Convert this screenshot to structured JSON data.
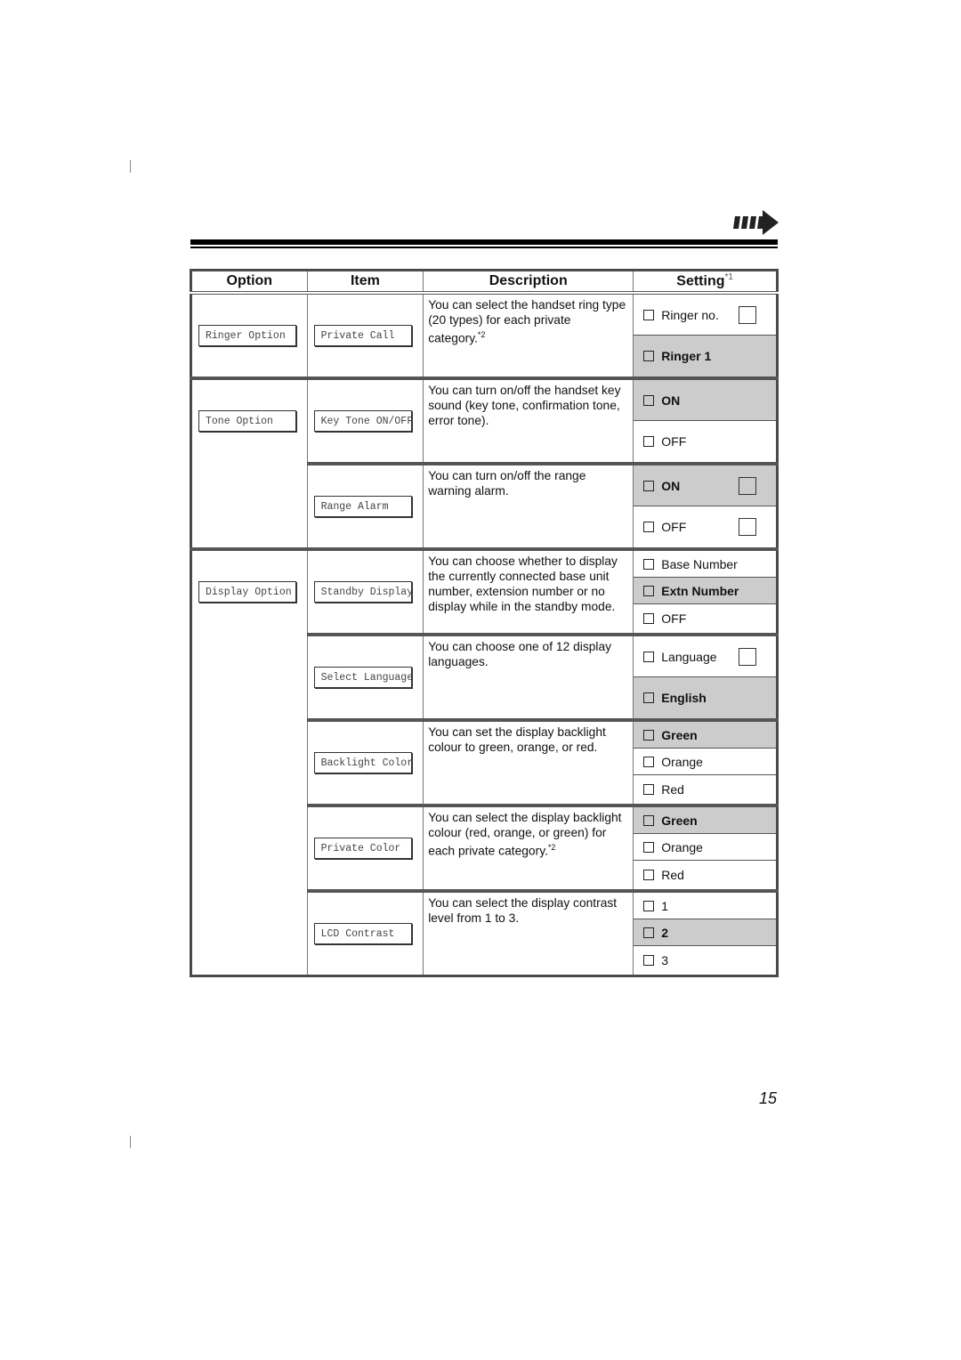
{
  "page": {
    "number": "15"
  },
  "header": {
    "continue_icon": "continue-arrow-icon"
  },
  "table": {
    "columns": [
      "Option",
      "Item",
      "Description",
      "Setting"
    ],
    "setting_footnote": "*1",
    "groups": [
      {
        "option": "Ringer Option",
        "items": [
          {
            "item": "Private Call",
            "description": "You can select the handset ring type (20 types) for each private category.",
            "footnote": "*2",
            "settings": [
              {
                "label": "Ringer no.",
                "selected": false,
                "entry_box": true
              },
              {
                "label": "Ringer 1",
                "selected": true,
                "entry_box": false
              }
            ]
          }
        ]
      },
      {
        "option": "Tone Option",
        "items": [
          {
            "item": "Key Tone ON/OFF",
            "description": "You can turn on/off the handset key sound (key tone, confirmation tone, error tone).",
            "footnote": "",
            "settings": [
              {
                "label": "ON",
                "selected": true,
                "entry_box": false
              },
              {
                "label": "OFF",
                "selected": false,
                "entry_box": false
              }
            ]
          },
          {
            "item": "Range Alarm",
            "description": "You can turn on/off the range warning alarm.",
            "footnote": "",
            "settings": [
              {
                "label": "ON",
                "selected": true,
                "entry_box": true
              },
              {
                "label": "OFF",
                "selected": false,
                "entry_box": true
              }
            ]
          }
        ]
      },
      {
        "option": "Display Option",
        "items": [
          {
            "item": "Standby Display",
            "description": "You can choose whether to display the currently connected base unit number, extension number or no display while in the standby mode.",
            "footnote": "",
            "settings": [
              {
                "label": "Base Number",
                "selected": false,
                "entry_box": false
              },
              {
                "label": "Extn Number",
                "selected": true,
                "entry_box": false
              },
              {
                "label": "OFF",
                "selected": false,
                "entry_box": false
              }
            ]
          },
          {
            "item": "Select Language",
            "description": "You can choose one of 12 display languages.",
            "footnote": "",
            "settings": [
              {
                "label": "Language",
                "selected": false,
                "entry_box": true
              },
              {
                "label": "English",
                "selected": true,
                "entry_box": false
              }
            ]
          },
          {
            "item": "Backlight Color",
            "description": "You can set the display backlight colour to green, orange, or red.",
            "footnote": "",
            "settings": [
              {
                "label": "Green",
                "selected": true,
                "entry_box": false
              },
              {
                "label": "Orange",
                "selected": false,
                "entry_box": false
              },
              {
                "label": "Red",
                "selected": false,
                "entry_box": false
              }
            ]
          },
          {
            "item": "Private Color",
            "description": "You can select the display backlight colour (red, orange, or green) for each private category.",
            "footnote": "*2",
            "settings": [
              {
                "label": "Green",
                "selected": true,
                "entry_box": false
              },
              {
                "label": "Orange",
                "selected": false,
                "entry_box": false
              },
              {
                "label": "Red",
                "selected": false,
                "entry_box": false
              }
            ]
          },
          {
            "item": "LCD Contrast",
            "description": "You can select the display contrast level from 1 to 3.",
            "footnote": "",
            "settings": [
              {
                "label": "1",
                "selected": false,
                "entry_box": false
              },
              {
                "label": "2",
                "selected": true,
                "entry_box": false
              },
              {
                "label": "3",
                "selected": false,
                "entry_box": false
              }
            ]
          }
        ]
      }
    ]
  }
}
